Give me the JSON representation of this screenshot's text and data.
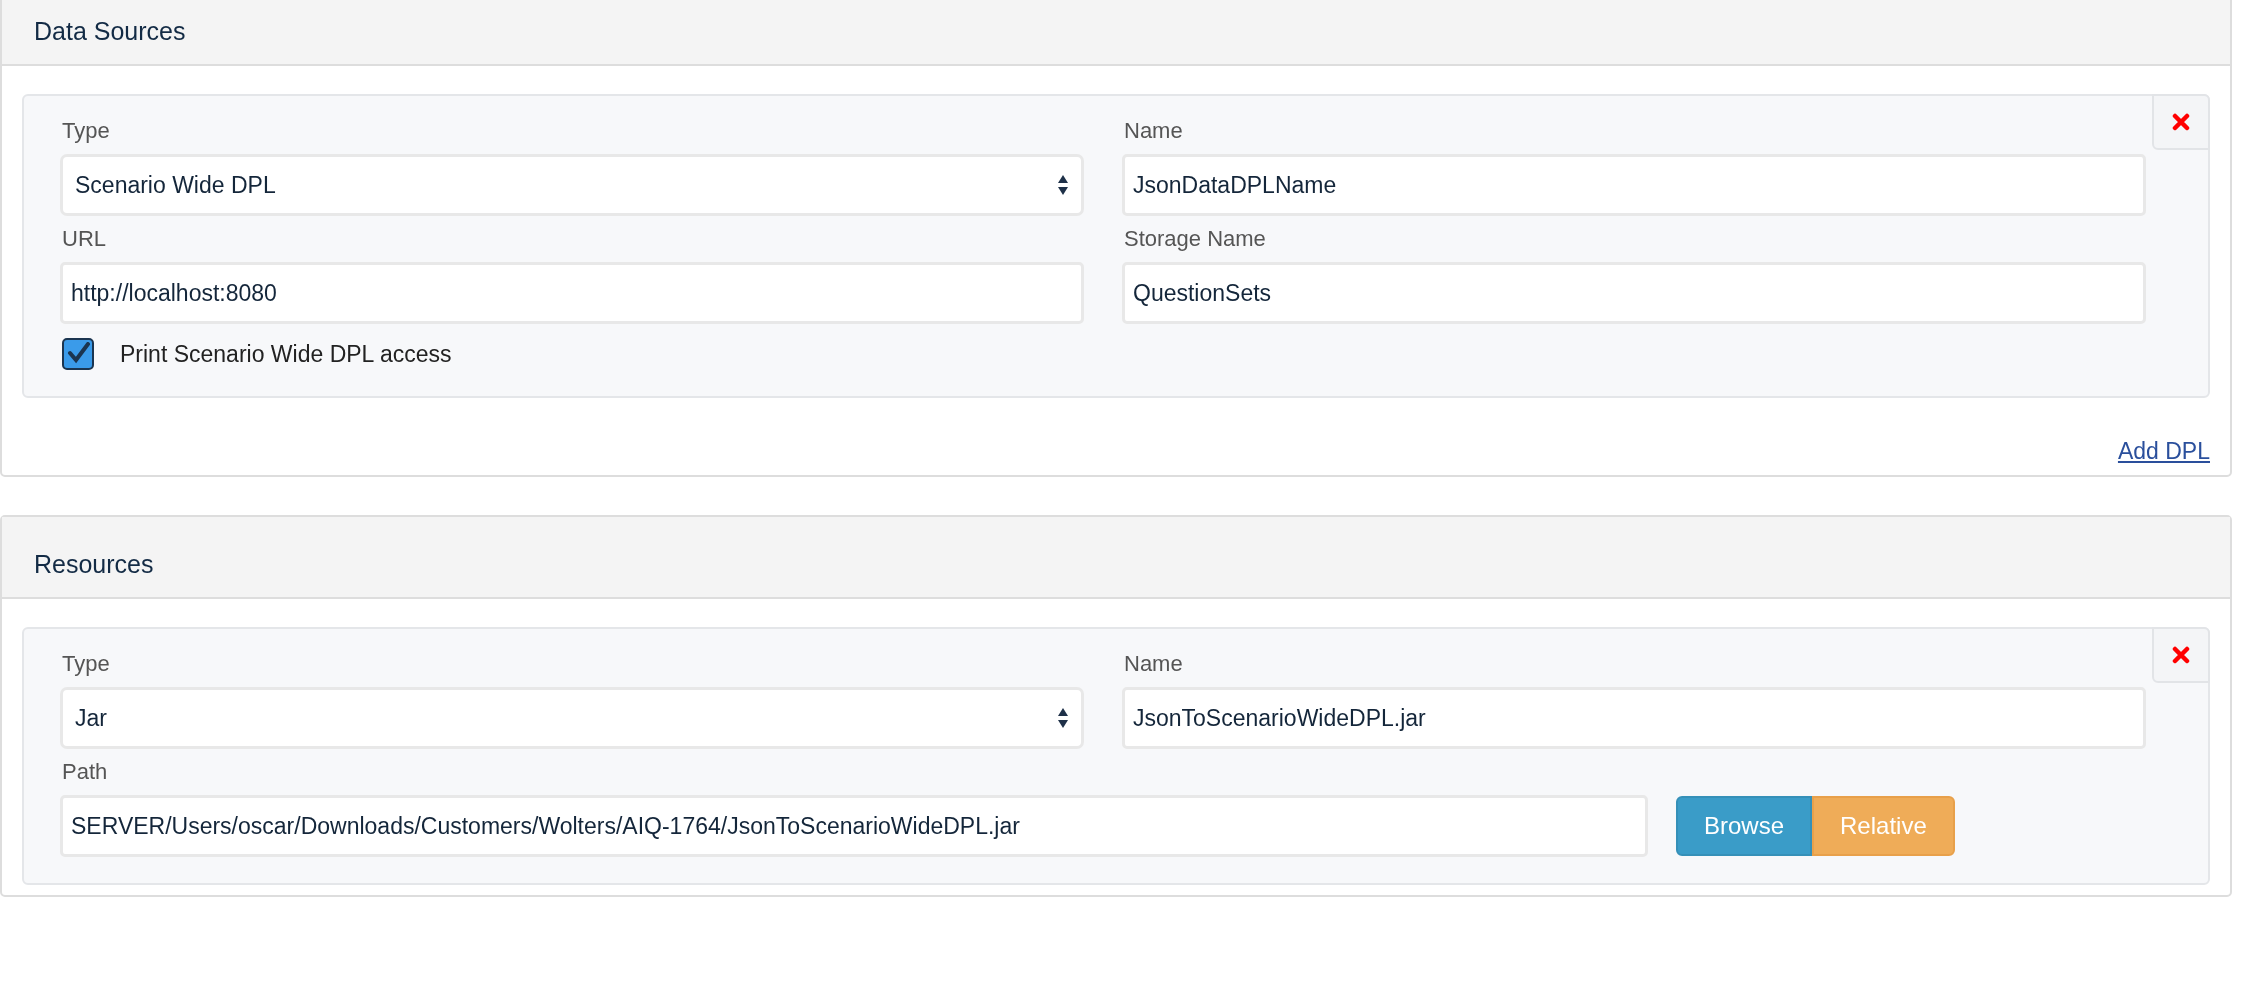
{
  "data_sources": {
    "title": "Data Sources",
    "entries": [
      {
        "type_label": "Type",
        "type_value": "Scenario Wide DPL",
        "name_label": "Name",
        "name_value": "JsonDataDPLName",
        "url_label": "URL",
        "url_value": "http://localhost:8080",
        "storage_label": "Storage Name",
        "storage_value": "QuestionSets",
        "checkbox": {
          "label": "Print Scenario Wide DPL access",
          "checked": true
        }
      }
    ],
    "add_link": "Add DPL"
  },
  "resources": {
    "title": "Resources",
    "entries": [
      {
        "type_label": "Type",
        "type_value": "Jar",
        "name_label": "Name",
        "name_value": "JsonToScenarioWideDPL.jar",
        "path_label": "Path",
        "path_value": "SERVER/Users/oscar/Downloads/Customers/Wolters/AIQ-1764/JsonToScenarioWideDPL.jar",
        "buttons": [
          {
            "label": "Browse",
            "kind": "info"
          },
          {
            "label": "Relative",
            "kind": "warning"
          }
        ]
      }
    ]
  }
}
